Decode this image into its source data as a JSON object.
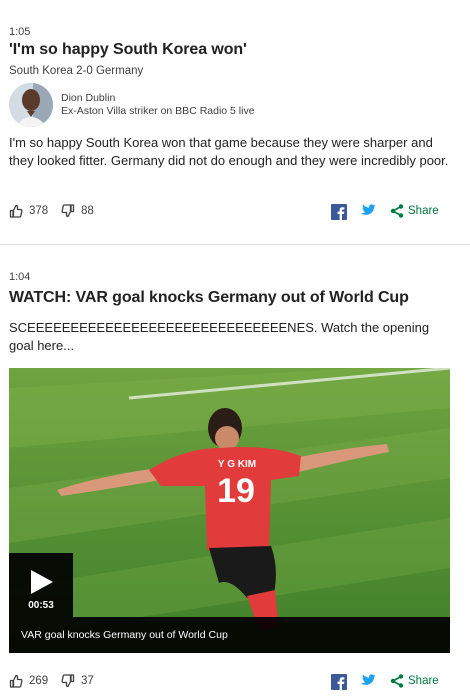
{
  "post1": {
    "time": "1:05",
    "headline": "'I'm so happy South Korea won'",
    "subhead": "South Korea 2-0 Germany",
    "contributor_name": "Dion Dublin",
    "contributor_role": "Ex-Aston Villa striker on BBC Radio 5 live",
    "body": "I'm so happy South Korea won that game because they were sharper and they looked fitter. Germany did not do enough and they were incredibly poor.",
    "likes": "378",
    "dislikes": "88",
    "share_label": "Share"
  },
  "post2": {
    "time": "1:04",
    "headline": "WATCH: VAR goal knocks Germany out of World Cup",
    "body": "SCEEEEEEEEEEEEEEEEEEEEEEEEEEEEEENES. Watch the opening goal here...",
    "video": {
      "duration": "00:53",
      "caption": "VAR goal knocks Germany out of World Cup",
      "shirt_name": "Y G KIM",
      "shirt_number": "19"
    },
    "likes": "269",
    "dislikes": "37",
    "share_label": "Share"
  },
  "colors": {
    "share_green": "#007a3d",
    "facebook_blue": "#3b5998",
    "twitter_blue": "#1da1f2",
    "divider": "#e0e0e0"
  },
  "icons": [
    "thumbs-up-icon",
    "thumbs-down-icon",
    "facebook-icon",
    "twitter-icon",
    "share-icon",
    "play-icon"
  ]
}
